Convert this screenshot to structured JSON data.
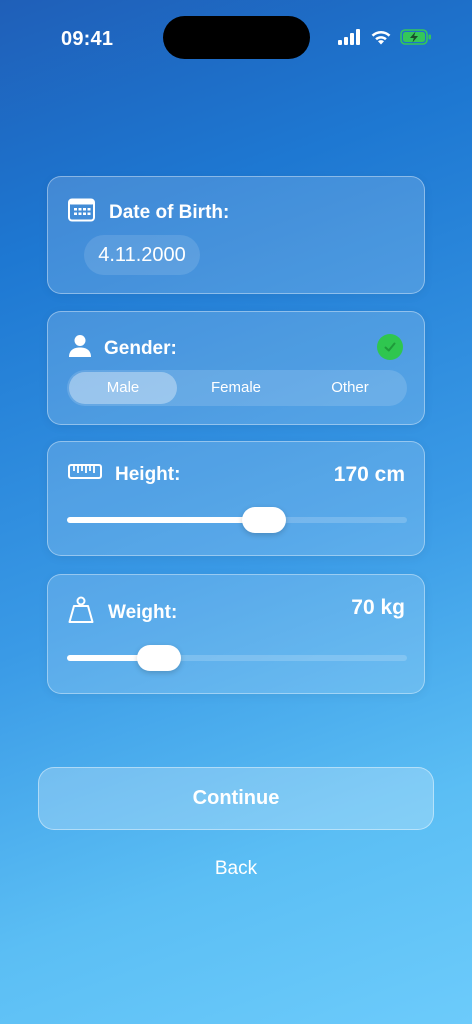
{
  "status_bar": {
    "time": "09:41",
    "icons": [
      "cellular-signal-icon",
      "wifi-icon",
      "battery-charging-icon"
    ],
    "battery_color": "#34c759"
  },
  "date_of_birth": {
    "icon": "calendar-icon",
    "label": "Date of Birth:",
    "value": "4.11.2000"
  },
  "gender": {
    "icon": "person-icon",
    "label": "Gender:",
    "status_icon": "checkmark-circle-icon",
    "status_color": "#2fc64f",
    "options": [
      "Male",
      "Female",
      "Other"
    ],
    "selected": "Male"
  },
  "height": {
    "icon": "ruler-icon",
    "label": "Height:",
    "value_text": "170 cm",
    "slider_fraction": 0.58
  },
  "weight": {
    "icon": "weight-icon",
    "label": "Weight:",
    "value_text": "70 kg",
    "slider_fraction": 0.27
  },
  "actions": {
    "continue_label": "Continue",
    "back_label": "Back"
  }
}
